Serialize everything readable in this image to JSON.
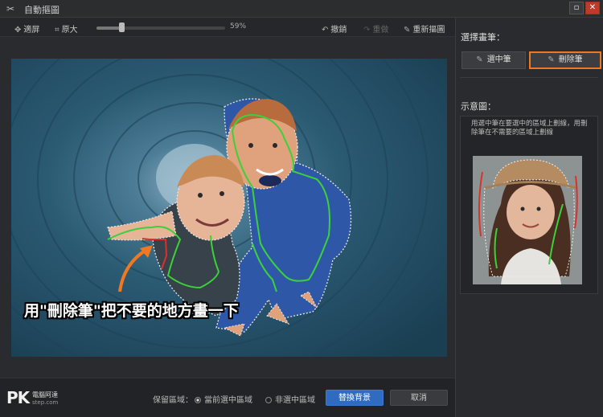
{
  "window": {
    "title": "自動摳圖"
  },
  "toolbar": {
    "fit_label": "適屏",
    "original_label": "原大",
    "zoom_percent": 59,
    "zoom_text": "59%",
    "undo_label": "撤銷",
    "redo_label": "重做",
    "reselect_label": "重新摳圖"
  },
  "canvas": {
    "annotation": "用\"刪除筆\"把不要的地方畫一下"
  },
  "footer": {
    "brand_logo": "PK",
    "brand_name": "電腦阿達",
    "brand_url": "step.com",
    "keep_label": "保留區域：",
    "option_selected_label": "當前選中區域",
    "option_unselected_label": "非選中區域",
    "replace_bg_label": "替換背景",
    "cancel_label": "取消"
  },
  "side": {
    "brush_heading": "選擇畫筆：",
    "select_brush_label": "選中筆",
    "delete_brush_label": "刪除筆",
    "demo_heading": "示意圖：",
    "demo_desc": "用選中筆在要選中的區域上劃線，用刪除筆在不需要的區域上劃線"
  },
  "colors": {
    "accent_orange": "#f07820",
    "primary_blue": "#2f6cc1",
    "select_stroke": "#3ad13a",
    "delete_stroke": "#d6332b"
  }
}
